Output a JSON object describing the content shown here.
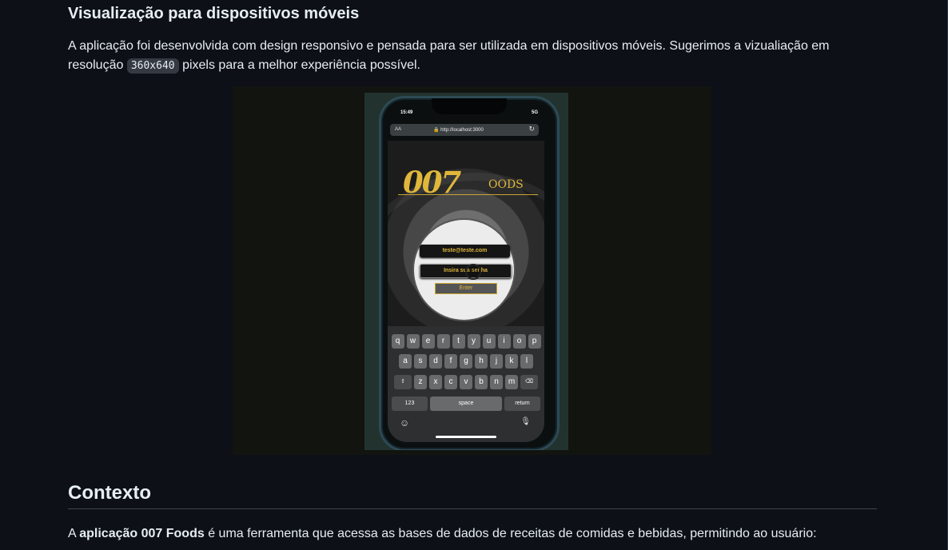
{
  "section": {
    "heading": "Visualização para dispositivos móveis",
    "text_before": "A aplicação foi desenvolvida com design responsivo e pensada para ser utilizada em dispositivos móveis. Sugerimos a vizualiação em resolução ",
    "resolution_code": "360x640",
    "text_after": " pixels para a melhor experiência possível."
  },
  "phone": {
    "time": "15:49",
    "network": "5G",
    "url_aa": "AA",
    "url": "http://localhost:3000",
    "logo_main": "007",
    "logo_sub": "OODS",
    "email_value": "teste@teste.com",
    "password_placeholder": "Insira sua senha",
    "enter_label": "Enter",
    "keyboard": {
      "row1": [
        "q",
        "w",
        "e",
        "r",
        "t",
        "y",
        "u",
        "i",
        "o",
        "p"
      ],
      "row2": [
        "a",
        "s",
        "d",
        "f",
        "g",
        "h",
        "j",
        "k",
        "l"
      ],
      "row3": [
        "z",
        "x",
        "c",
        "v",
        "b",
        "n",
        "m"
      ],
      "shift": "⇧",
      "backspace": "⌫",
      "numbers": "123",
      "space": "space",
      "return": "return",
      "emoji": "☺",
      "mic": "🎙"
    }
  },
  "context": {
    "heading": "Contexto",
    "text_prefix": "A ",
    "text_bold": "aplicação 007 Foods",
    "text_suffix": " é uma ferramenta que acessa as bases de dados de receitas de comidas e bebidas, permitindo ao usuário:"
  },
  "colors": {
    "background": "#0d1117",
    "text": "#e6edf3",
    "gold": "#e0b73b"
  }
}
